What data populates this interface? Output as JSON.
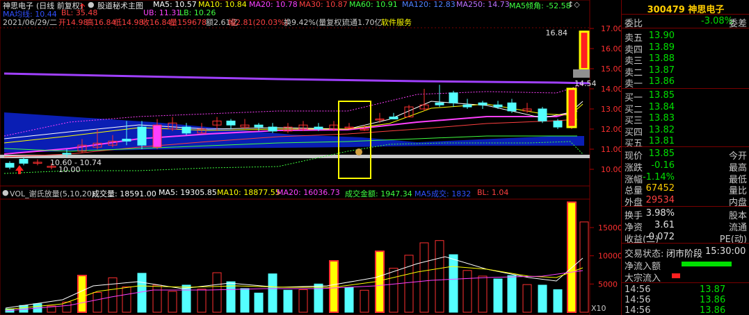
{
  "top_bar": {
    "stock_name": "神思电子",
    "period": "(日线 前复权)",
    "indicator": "股道秘术主图",
    "ma5": "MA5: 10.57",
    "ma10": "MA10: 10.84",
    "ma20": "MA20: 10.78",
    "ma30": "MA30: 10.87",
    "ma60": "MA60: 10.91",
    "ma120": "MA120: 12.83",
    "ma250": "MA250: 14.73",
    "ma5_angle": "MA5倾角: -52.58",
    "m5_label": "MA5倾角",
    "bl_left": "BL: 35.48",
    "ub": "UB: 11.31",
    "lb": "LB: 10.26",
    "hidden_left": "MA均线: 10.44"
  },
  "info_bar": {
    "date": "2021/06/29/二",
    "open": "开14.98",
    "high": "高16.84",
    "low": "低14.98",
    "close": "收16.84",
    "vol": "量159678",
    "amount": "额2.61亿",
    "amp": "幅2.81(20.03%)",
    "turnover": "换9.42%(量复权)",
    "float": "流通1.70亿",
    "sector": "软件服务"
  },
  "price_axis": [
    "17.00",
    "16.00",
    "15.00",
    "14.00",
    "13.00",
    "12.00",
    "11.00",
    "10.00"
  ],
  "annotations": {
    "peak_label": "16.84",
    "right_label": "14.54",
    "range_label": "10.60 - 10.74",
    "low_label": "10.00"
  },
  "volume_bar": {
    "title": "VOL_谢氏放量(5,10,20)",
    "volume": "成交量: 18591.00",
    "ma5": "MA5: 19305.85",
    "ma10": "MA10: 18877.55",
    "ma20": "MA20: 16036.73",
    "amount": "成交金额: 1947.34",
    "hidden": "MA5成交: 1832",
    "bl": "BL: 1.04"
  },
  "volume_axis": [
    "15000",
    "10000",
    "5000"
  ],
  "volume_unit": "X10",
  "panel": {
    "code": "300479",
    "name": "神思电子",
    "weibi_label": "委比",
    "weibi": "-3.08%",
    "weicha_label": "委差",
    "sells": [
      {
        "label": "卖五",
        "price": "13.90"
      },
      {
        "label": "卖四",
        "price": "13.89"
      },
      {
        "label": "卖三",
        "price": "13.88"
      },
      {
        "label": "卖二",
        "price": "13.87"
      },
      {
        "label": "卖一",
        "price": "13.86"
      }
    ],
    "buys": [
      {
        "label": "买一",
        "price": "13.85"
      },
      {
        "label": "买二",
        "price": "13.84"
      },
      {
        "label": "买三",
        "price": "13.83"
      },
      {
        "label": "买四",
        "price": "13.82"
      },
      {
        "label": "买五",
        "price": "13.81"
      }
    ],
    "stats": [
      {
        "l1": "现价",
        "v": "13.85",
        "l2": "今开",
        "c": "green"
      },
      {
        "l1": "涨跌",
        "v": "-0.16",
        "l2": "最高",
        "c": "green"
      },
      {
        "l1": "涨幅",
        "v": "-1.14%",
        "l2": "最低",
        "c": "green"
      },
      {
        "l1": "总量",
        "v": "67452",
        "l2": "量比",
        "c": "orange"
      },
      {
        "l1": "外盘",
        "v": "29534",
        "l2": "内盘",
        "c": "red"
      }
    ],
    "stats2": [
      {
        "l1": "换手",
        "v": "3.98%",
        "l2": "股本",
        "c": "white"
      },
      {
        "l1": "净资",
        "v": "3.61",
        "l2": "流通",
        "c": "white"
      },
      {
        "l1": "收益(二)",
        "v": "-0.072",
        "l2": "PE(动)",
        "c": "white"
      }
    ],
    "status_label": "交易状态:",
    "status": "闭市阶段",
    "time": "15:30:00",
    "net_inflow": "净流入额",
    "block_inflow": "大宗流入",
    "ticks": [
      {
        "t": "14:56",
        "p": "13.87"
      },
      {
        "t": "14:56",
        "p": "13.86"
      },
      {
        "t": "14:56",
        "p": "13.86"
      }
    ]
  },
  "colors": {
    "up": "#ff3030",
    "down": "#54ffff",
    "volume_highlight": "#ffff00",
    "accent_purple": "#a040ff",
    "fill_blue": "#0a1eb4"
  }
}
